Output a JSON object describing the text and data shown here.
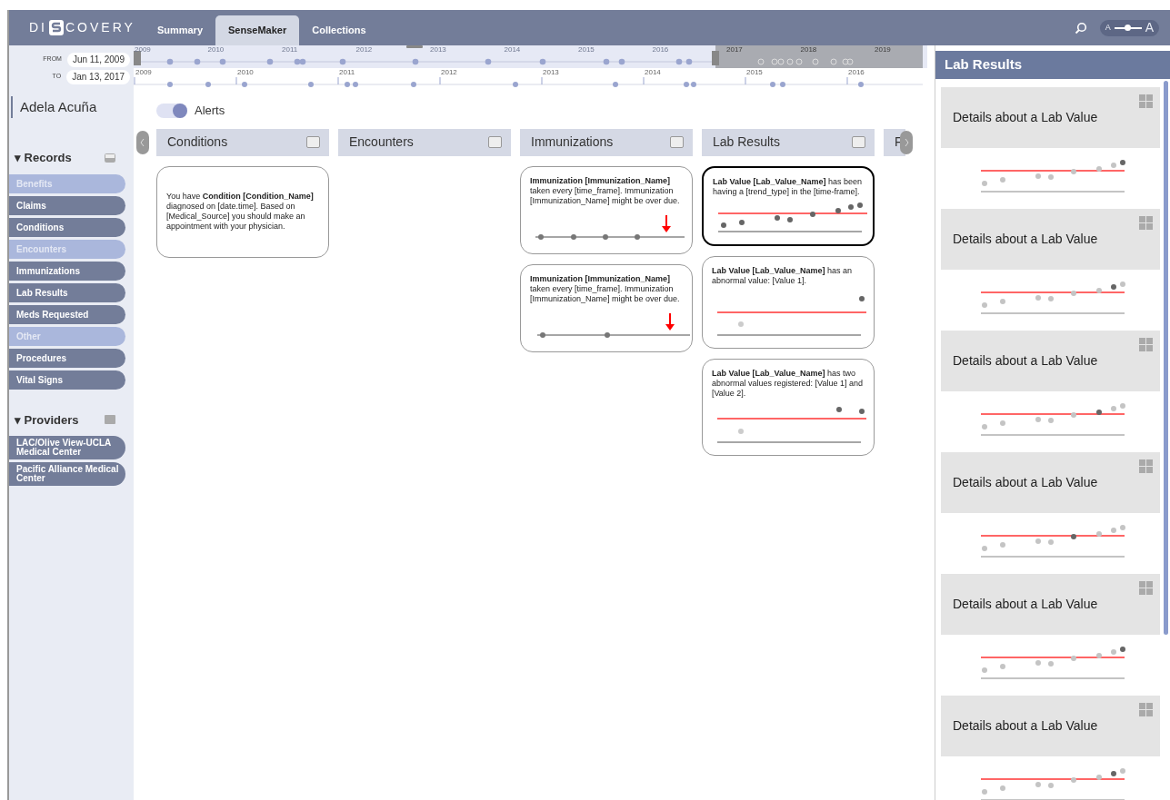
{
  "app": {
    "logo": "DI",
    "logo_rest": "COVERY"
  },
  "tabs": [
    {
      "label": "Summary",
      "selected": false
    },
    {
      "label": "SenseMaker",
      "selected": true
    },
    {
      "label": "Collections",
      "selected": false
    }
  ],
  "font_size_control": {
    "small": "A",
    "large": "A",
    "level": 0.5
  },
  "date_range": {
    "from_label": "FROM",
    "from": "Jun 11, 2009",
    "to_label": "TO",
    "to": "Jan 13, 2017"
  },
  "timeline": {
    "overview_years": [
      "2009",
      "2010",
      "2011",
      "2012",
      "2013",
      "2014",
      "2015",
      "2016",
      "2017",
      "2018",
      "2019"
    ],
    "detail_years": [
      "2009",
      "2010",
      "2011",
      "2012",
      "2013",
      "2014",
      "2015",
      "2016"
    ]
  },
  "patient": "Adela Acuña",
  "alerts": {
    "label": "Alerts",
    "on": true
  },
  "records": {
    "title": "▾ Records",
    "items": [
      {
        "label": "Benefits",
        "active": false
      },
      {
        "label": "Claims",
        "active": true
      },
      {
        "label": "Conditions",
        "active": true
      },
      {
        "label": "Encounters",
        "active": false
      },
      {
        "label": "Immunizations",
        "active": true
      },
      {
        "label": "Lab Results",
        "active": true
      },
      {
        "label": "Meds Requested",
        "active": true
      },
      {
        "label": "Other",
        "active": false
      },
      {
        "label": "Procedures",
        "active": true
      },
      {
        "label": "Vital Signs",
        "active": true
      }
    ]
  },
  "providers": {
    "title": "▾ Providers",
    "items": [
      {
        "label": "LAC/Olive View-UCLA Medical Center",
        "active": true
      },
      {
        "label": "Pacific Alliance Medical Center",
        "active": true
      }
    ]
  },
  "columns": [
    {
      "title": "Conditions",
      "checked": false,
      "cards": [
        {
          "kind": "condition",
          "selected": false,
          "text": "You have **Condition [Condition_Name]** diagnosed on [date.time]. Based on [Medical_Source] you should make an appointment with your physician."
        }
      ]
    },
    {
      "title": "Encounters",
      "checked": false
    },
    {
      "title": "Immunizations",
      "checked": false,
      "cards": [
        {
          "kind": "immunization",
          "selected": false,
          "text": "**Immunization [Immunization_Name]** taken every [time_frame]. Immunization [Immunization_Name] might be over due."
        },
        {
          "kind": "immunization_sparse",
          "selected": false,
          "text": "**Immunization [Immunization_Name]** taken every [time_frame]. Immunization [Immunization_Name] might be over due."
        }
      ]
    },
    {
      "title": "Lab Results",
      "checked": false,
      "cards": [
        {
          "kind": "lab_trend",
          "selected": true,
          "text": "**Lab Value [Lab_Value_Name]** has been having a [trend_type] in the [time-frame]."
        },
        {
          "kind": "lab_abnormal",
          "selected": false,
          "text": "**Lab Value [Lab_Value_Name]** has an abnormal value: [Value 1]."
        },
        {
          "kind": "lab_two_abnormal",
          "selected": false,
          "text": "**Lab Value [Lab_Value_Name]** has two abnormal values registered: [Value 1] and [Value 2]."
        }
      ]
    },
    {
      "title": "F"
    }
  ],
  "detail_panel": {
    "title": "Lab Results",
    "cards": [
      {
        "title": "Details about a Lab Value"
      },
      {
        "title": "Details about a Lab Value"
      },
      {
        "title": "Details about a Lab Value"
      },
      {
        "title": "Details about a Lab Value"
      },
      {
        "title": "Details about a Lab Value"
      },
      {
        "title": "Details about a Lab Value"
      }
    ]
  }
}
